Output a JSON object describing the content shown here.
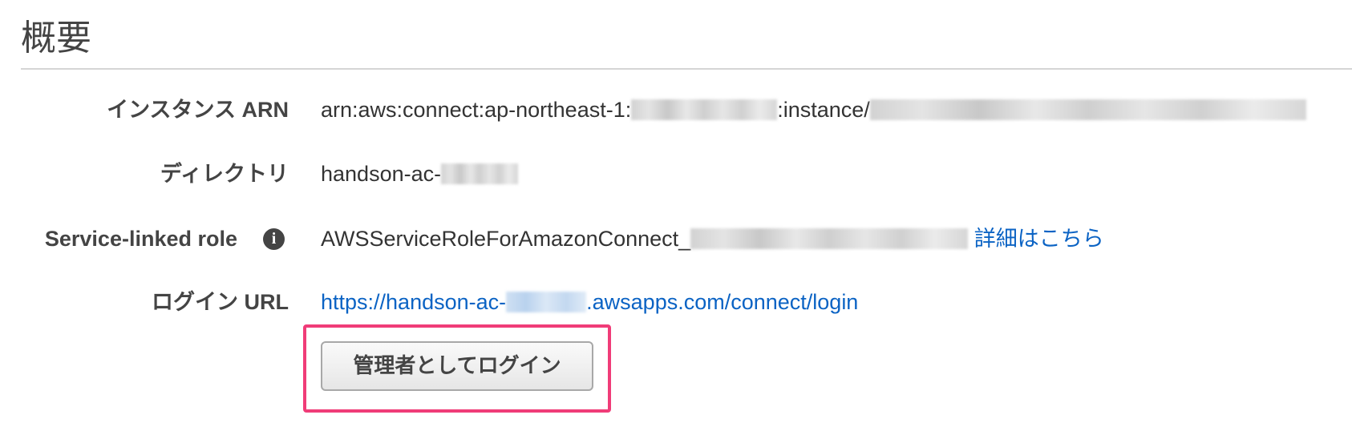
{
  "section": {
    "title": "概要"
  },
  "rows": {
    "instance_arn": {
      "label": "インスタンス ARN",
      "value_prefix": "arn:aws:connect:ap-northeast-1:",
      "value_middle": ":instance/"
    },
    "directory": {
      "label": "ディレクトリ",
      "value_prefix": "handson-ac-"
    },
    "service_linked_role": {
      "label": "Service-linked role",
      "info_icon": "info-icon",
      "value_prefix": "AWSServiceRoleForAmazonConnect_",
      "details_link": "詳細はこちら"
    },
    "login_url": {
      "label": "ログイン URL",
      "url_prefix": "https://handson-ac-",
      "url_suffix": ".awsapps.com/connect/login"
    }
  },
  "actions": {
    "login_as_admin": "管理者としてログイン"
  },
  "colors": {
    "link": "#0b63c4",
    "highlight": "#f03c78"
  }
}
